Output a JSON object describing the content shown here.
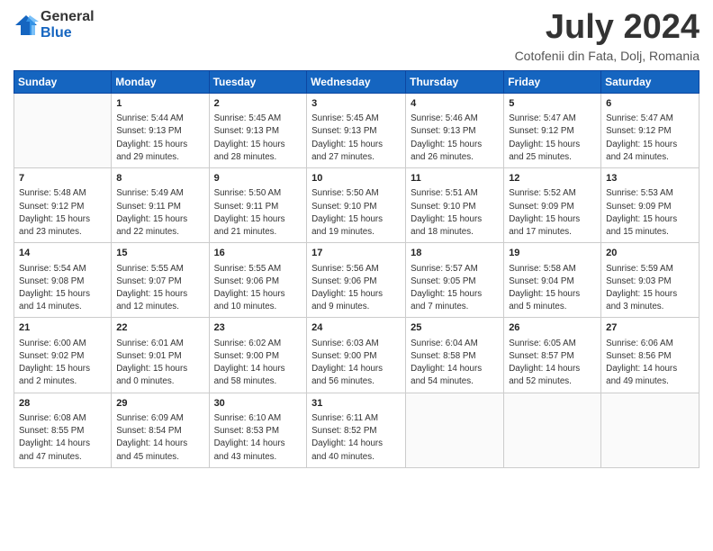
{
  "logo": {
    "general": "General",
    "blue": "Blue"
  },
  "title": {
    "month": "July 2024",
    "location": "Cotofenii din Fata, Dolj, Romania"
  },
  "weekdays": [
    "Sunday",
    "Monday",
    "Tuesday",
    "Wednesday",
    "Thursday",
    "Friday",
    "Saturday"
  ],
  "weeks": [
    [
      {
        "day": "",
        "info": ""
      },
      {
        "day": "1",
        "info": "Sunrise: 5:44 AM\nSunset: 9:13 PM\nDaylight: 15 hours\nand 29 minutes."
      },
      {
        "day": "2",
        "info": "Sunrise: 5:45 AM\nSunset: 9:13 PM\nDaylight: 15 hours\nand 28 minutes."
      },
      {
        "day": "3",
        "info": "Sunrise: 5:45 AM\nSunset: 9:13 PM\nDaylight: 15 hours\nand 27 minutes."
      },
      {
        "day": "4",
        "info": "Sunrise: 5:46 AM\nSunset: 9:13 PM\nDaylight: 15 hours\nand 26 minutes."
      },
      {
        "day": "5",
        "info": "Sunrise: 5:47 AM\nSunset: 9:12 PM\nDaylight: 15 hours\nand 25 minutes."
      },
      {
        "day": "6",
        "info": "Sunrise: 5:47 AM\nSunset: 9:12 PM\nDaylight: 15 hours\nand 24 minutes."
      }
    ],
    [
      {
        "day": "7",
        "info": "Sunrise: 5:48 AM\nSunset: 9:12 PM\nDaylight: 15 hours\nand 23 minutes."
      },
      {
        "day": "8",
        "info": "Sunrise: 5:49 AM\nSunset: 9:11 PM\nDaylight: 15 hours\nand 22 minutes."
      },
      {
        "day": "9",
        "info": "Sunrise: 5:50 AM\nSunset: 9:11 PM\nDaylight: 15 hours\nand 21 minutes."
      },
      {
        "day": "10",
        "info": "Sunrise: 5:50 AM\nSunset: 9:10 PM\nDaylight: 15 hours\nand 19 minutes."
      },
      {
        "day": "11",
        "info": "Sunrise: 5:51 AM\nSunset: 9:10 PM\nDaylight: 15 hours\nand 18 minutes."
      },
      {
        "day": "12",
        "info": "Sunrise: 5:52 AM\nSunset: 9:09 PM\nDaylight: 15 hours\nand 17 minutes."
      },
      {
        "day": "13",
        "info": "Sunrise: 5:53 AM\nSunset: 9:09 PM\nDaylight: 15 hours\nand 15 minutes."
      }
    ],
    [
      {
        "day": "14",
        "info": "Sunrise: 5:54 AM\nSunset: 9:08 PM\nDaylight: 15 hours\nand 14 minutes."
      },
      {
        "day": "15",
        "info": "Sunrise: 5:55 AM\nSunset: 9:07 PM\nDaylight: 15 hours\nand 12 minutes."
      },
      {
        "day": "16",
        "info": "Sunrise: 5:55 AM\nSunset: 9:06 PM\nDaylight: 15 hours\nand 10 minutes."
      },
      {
        "day": "17",
        "info": "Sunrise: 5:56 AM\nSunset: 9:06 PM\nDaylight: 15 hours\nand 9 minutes."
      },
      {
        "day": "18",
        "info": "Sunrise: 5:57 AM\nSunset: 9:05 PM\nDaylight: 15 hours\nand 7 minutes."
      },
      {
        "day": "19",
        "info": "Sunrise: 5:58 AM\nSunset: 9:04 PM\nDaylight: 15 hours\nand 5 minutes."
      },
      {
        "day": "20",
        "info": "Sunrise: 5:59 AM\nSunset: 9:03 PM\nDaylight: 15 hours\nand 3 minutes."
      }
    ],
    [
      {
        "day": "21",
        "info": "Sunrise: 6:00 AM\nSunset: 9:02 PM\nDaylight: 15 hours\nand 2 minutes."
      },
      {
        "day": "22",
        "info": "Sunrise: 6:01 AM\nSunset: 9:01 PM\nDaylight: 15 hours\nand 0 minutes."
      },
      {
        "day": "23",
        "info": "Sunrise: 6:02 AM\nSunset: 9:00 PM\nDaylight: 14 hours\nand 58 minutes."
      },
      {
        "day": "24",
        "info": "Sunrise: 6:03 AM\nSunset: 9:00 PM\nDaylight: 14 hours\nand 56 minutes."
      },
      {
        "day": "25",
        "info": "Sunrise: 6:04 AM\nSunset: 8:58 PM\nDaylight: 14 hours\nand 54 minutes."
      },
      {
        "day": "26",
        "info": "Sunrise: 6:05 AM\nSunset: 8:57 PM\nDaylight: 14 hours\nand 52 minutes."
      },
      {
        "day": "27",
        "info": "Sunrise: 6:06 AM\nSunset: 8:56 PM\nDaylight: 14 hours\nand 49 minutes."
      }
    ],
    [
      {
        "day": "28",
        "info": "Sunrise: 6:08 AM\nSunset: 8:55 PM\nDaylight: 14 hours\nand 47 minutes."
      },
      {
        "day": "29",
        "info": "Sunrise: 6:09 AM\nSunset: 8:54 PM\nDaylight: 14 hours\nand 45 minutes."
      },
      {
        "day": "30",
        "info": "Sunrise: 6:10 AM\nSunset: 8:53 PM\nDaylight: 14 hours\nand 43 minutes."
      },
      {
        "day": "31",
        "info": "Sunrise: 6:11 AM\nSunset: 8:52 PM\nDaylight: 14 hours\nand 40 minutes."
      },
      {
        "day": "",
        "info": ""
      },
      {
        "day": "",
        "info": ""
      },
      {
        "day": "",
        "info": ""
      }
    ]
  ]
}
